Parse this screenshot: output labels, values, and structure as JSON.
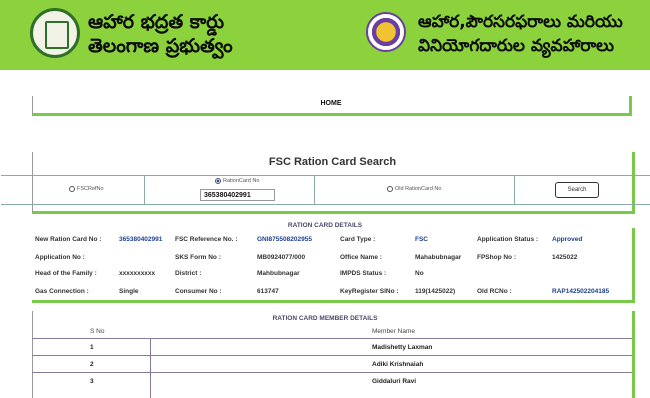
{
  "header": {
    "left_line1": "ఆహార భద్రత కార్డు",
    "left_line2": "తెలంగాణ ప్రభుత్వం",
    "right_line1": "ఆహార,పౌరసరఫరాలు మరియు",
    "right_line2": "వినియోగదారుల వ్యవహారాలు",
    "left_logo": "telangana-emblem",
    "right_logo": "civil-supplies-emblem",
    "bg_color": "#8cd23c"
  },
  "nav": {
    "home": "HOME"
  },
  "search": {
    "title": "FSC Ration Card Search",
    "options": [
      "FSCRefNo",
      "RationCard No",
      "Old RationCard No"
    ],
    "selected_option": "RationCard No",
    "input_value": "365380402991",
    "button_label": "Search"
  },
  "details": {
    "title": "RATION CARD DETAILS",
    "rows": [
      [
        {
          "label": "New Ration Card No :",
          "value": "365380402991",
          "blue": true
        },
        {
          "label": "FSC Reference No. :",
          "value": "GNI875508202955",
          "blue": true
        },
        {
          "label": "Card Type :",
          "value": "FSC",
          "blue": true
        },
        {
          "label": "Application Status :",
          "value": "Approved",
          "blue": true
        }
      ],
      [
        {
          "label": "Application No :",
          "value": ""
        },
        {
          "label": "SKS Form No :",
          "value": "MB0924077/000"
        },
        {
          "label": "Office Name :",
          "value": "Mahabubnagar"
        },
        {
          "label": "FPShop No :",
          "value": "1425022"
        }
      ],
      [
        {
          "label": "Head of the Family :",
          "value": "xxxxxxxxxx"
        },
        {
          "label": "District :",
          "value": "Mahbubnagar"
        },
        {
          "label": "IMPDS Status :",
          "value": "No"
        },
        {
          "label": "",
          "value": ""
        }
      ],
      [
        {
          "label": "Gas Connection :",
          "value": "Single"
        },
        {
          "label": "Consumer No :",
          "value": "613747"
        },
        {
          "label": "KeyRegister SlNo :",
          "value": "119(1425022)"
        },
        {
          "label": "Old RCNo :",
          "value": "RAP142502204185",
          "blue": true
        }
      ]
    ]
  },
  "members": {
    "title": "RATION CARD MEMBER DETAILS",
    "headers": [
      "S No",
      "Member Name"
    ],
    "rows": [
      {
        "sno": "1",
        "name": "Madishetty Laxman"
      },
      {
        "sno": "2",
        "name": "Adiki Krishnaiah"
      },
      {
        "sno": "3",
        "name": "Giddaluri Ravi"
      }
    ]
  }
}
